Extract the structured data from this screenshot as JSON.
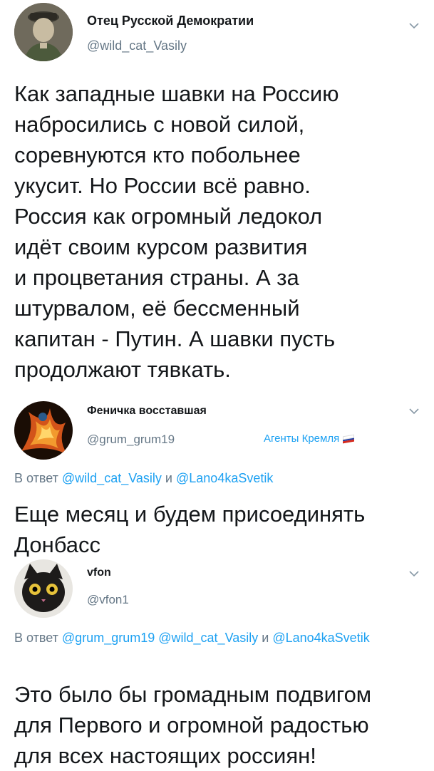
{
  "tweets": [
    {
      "author": "Отец Русской Демократии",
      "handle": "@wild_cat_Vasily",
      "text": "Как западные шавки на Россию\nнабросились с новой силой,\nсоревнуются кто побольнее\nукусит. Но России всё равно.\nРоссия как огромный ледокол\nидёт своим курсом развития\nи процветания страны. А за\nштурвалом, её бессменный\nкапитан - Путин. А шавки пусть\nпродолжают тявкать."
    },
    {
      "author": "Феничка восставшая",
      "handle": "@grum_grum19",
      "badge": "Агенты Кремля",
      "reply_prefix": "В ответ",
      "reply_mention_1": "@wild_cat_Vasily",
      "reply_and": "и",
      "reply_mention_2": "@Lano4kaSvetik",
      "text": "Еще месяц и будем присоединять\nДонбасс"
    },
    {
      "author": "vfon",
      "handle": "@vfon1",
      "reply_prefix": "В ответ",
      "reply_mention_1": "@grum_grum19",
      "reply_mention_2": "@wild_cat_Vasily",
      "reply_and": "и",
      "reply_mention_3": "@Lano4kaSvetik",
      "text": "Это было бы громадным подвигом\nдля Первого и огромной радостью\nдля всех настоящих россиян!"
    }
  ],
  "icons": {
    "chevron": "chevron-down-icon",
    "flag": "russian-flag-icon"
  },
  "colors": {
    "link": "#1da1f2",
    "secondary": "#657786",
    "text": "#14171a"
  }
}
